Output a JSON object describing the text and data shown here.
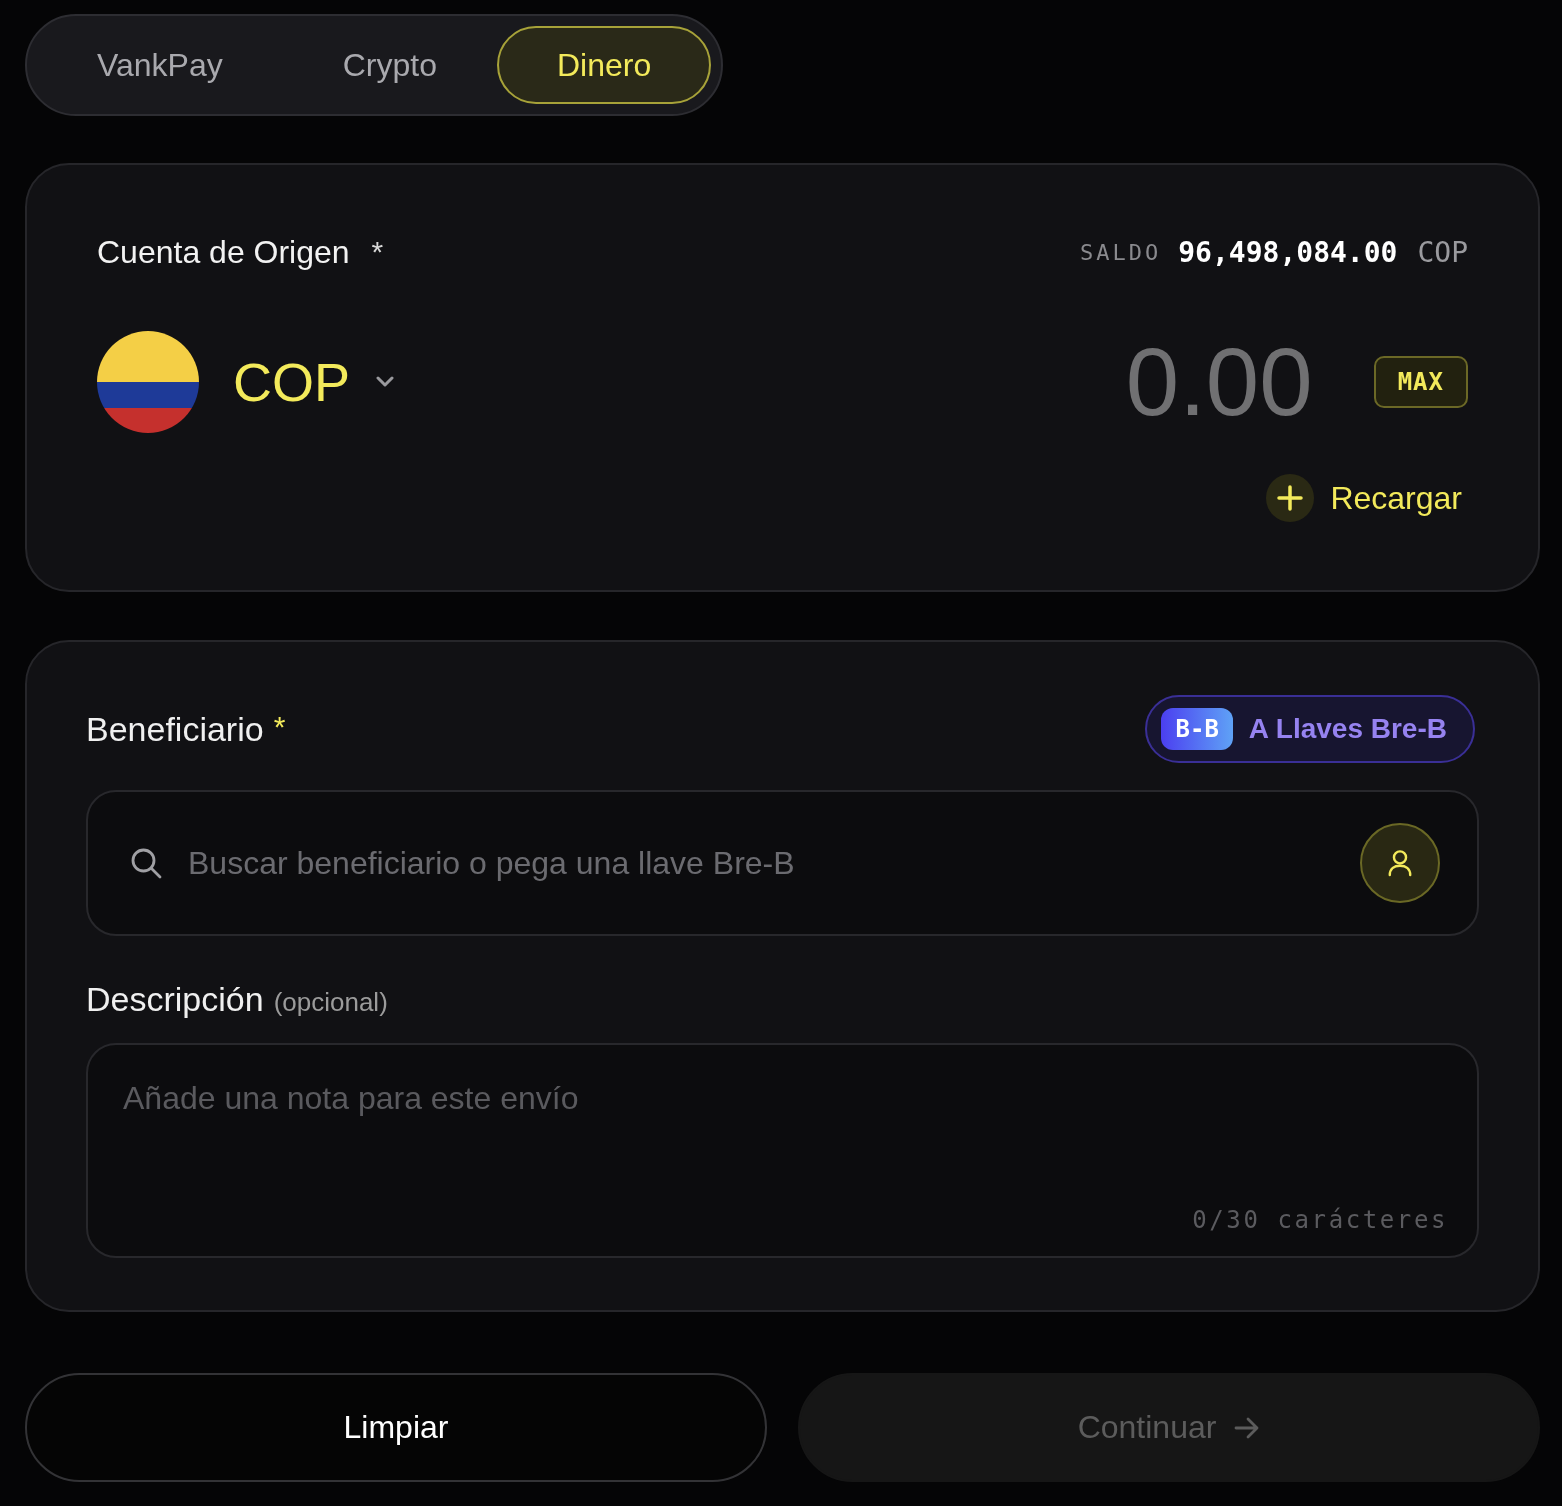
{
  "tabs": [
    {
      "label": "VankPay",
      "selected": false
    },
    {
      "label": "Crypto",
      "selected": false
    },
    {
      "label": "Dinero",
      "selected": true
    }
  ],
  "origin_card": {
    "label": "Cuenta de Origen",
    "required_mark": "*",
    "balance_label": "SALDO",
    "balance_amount": "96,498,084.00",
    "balance_currency": "COP",
    "currency": "COP",
    "amount": {
      "placeholder": "0.00"
    },
    "max_button": "MAX",
    "topup_button": "Recargar"
  },
  "beneficiary_card": {
    "label": "Beneficiario",
    "required_mark": "*",
    "breb_button": {
      "tag": "B-B",
      "label": "A Llaves Bre-B"
    },
    "search": {
      "placeholder": "Buscar beneficiario o pega una llave Bre-B"
    },
    "description": {
      "label": "Descripción",
      "hint": "(opcional)",
      "placeholder": "Añade una nota para este envío",
      "counter": "0/30 carácteres"
    }
  },
  "buttons": [
    {
      "label": "Limpiar",
      "kind": "secondary",
      "disabled": false
    },
    {
      "label": "Continuar",
      "kind": "primary",
      "disabled": true
    }
  ]
}
